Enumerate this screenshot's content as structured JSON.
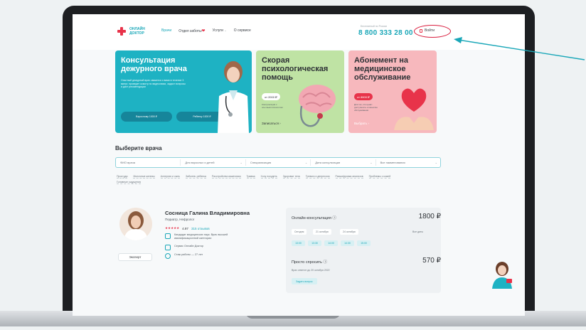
{
  "colors": {
    "brand": "#1aa7b8",
    "accent": "#e8334a",
    "highlight": "#d91f3f"
  },
  "header": {
    "logo_text": "ОНЛАЙН ДОКТОР",
    "nav": [
      "Врачи",
      "Отдел заботы",
      "Услуги",
      "О сервисе"
    ],
    "phone_caption": "Бесплатный по России",
    "phone": "8 800 333 28 00",
    "login": "Войти"
  },
  "banners": {
    "duty": {
      "title": "Консультация дежурного врача",
      "desc": "Опытный дежурный врач свяжется с вами в течение 3 минут, проведет осмотр по видеосвязи, задаст вопросы и даст рекомендации",
      "btn1": "Взрослому 1000 ₽",
      "btn2": "Ребенку 1000 ₽"
    },
    "psych": {
      "title": "Скорая психологическая помощь",
      "price": "от 2000 ₽",
      "note": "Консультация с опытным психологом",
      "link": "Записаться ›"
    },
    "sub": {
      "title": "Абонемент на медицинское обслуживание",
      "price": "от 8900 ₽",
      "note": "Для тех, кто ценит доступность и качество обслуживания",
      "link": "Выбрать ›"
    }
  },
  "filters": {
    "title": "Выберите врача",
    "fields": [
      "ФИО врача",
      "Для взрослых и детей",
      "Специализация",
      "Дата консультации",
      "Все наименования"
    ],
    "tags": [
      "Простуда",
      "Молочные железы",
      "Аллергия и сыпь",
      "Заболев. ребенка",
      "Расстройства кишечника",
      "Травма",
      "Хочу похудеть",
      "Здоровье тела",
      "Тревога и депрессия",
      "Расшифровка анализов",
      "Проблемы с кожей",
      "Головные ощущения"
    ]
  },
  "doctor": {
    "name": "Сосница Галина Владимировна",
    "spec": "Педиатр, Нефролог",
    "stars": "★★★★★",
    "rating": "4.97",
    "reviews": "315 отзывов",
    "info": [
      "Кандидат медицинских наук. Врач высшей квалификационной категории",
      "Сервис Онлайн Доктор",
      "Стаж работы — 27 лет"
    ],
    "badge": "Эксперт"
  },
  "consult": {
    "online_label": "Онлайн-консультация ⓘ",
    "online_price": "1800 ₽",
    "days": [
      "Сегодня",
      "21 октября",
      "24 октября"
    ],
    "all_days": "Все даты",
    "slots": [
      "13:00",
      "13:30",
      "14:00",
      "14:30",
      "15:00"
    ],
    "ask_label": "Просто спросить ⓘ",
    "ask_price": "570 ₽",
    "ask_note": "Врач ответит до 20 октября 2022",
    "ask_btn": "Задать вопрос"
  }
}
